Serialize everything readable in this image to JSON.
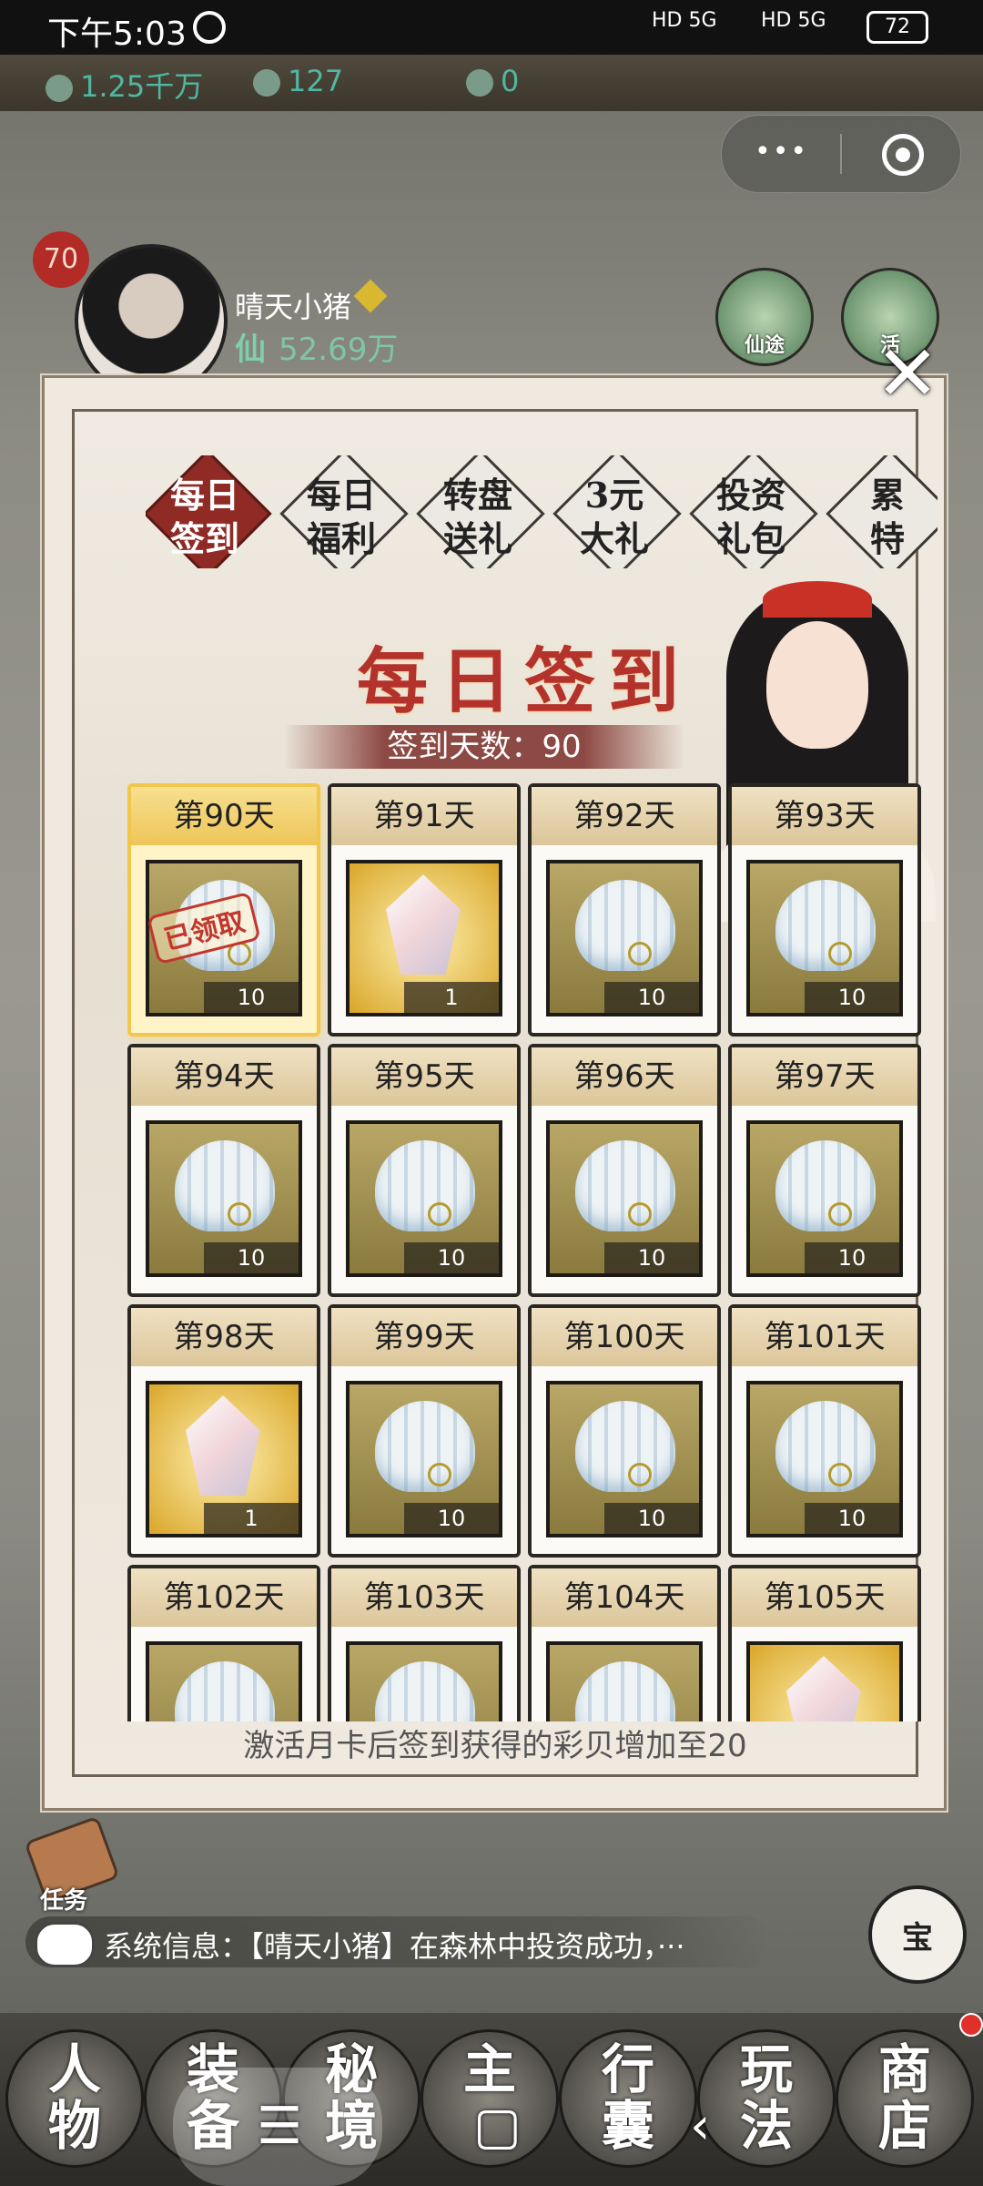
{
  "status_bar": {
    "time": "下午5:03",
    "network": "HD 5G",
    "network2": "HD 5G",
    "battery": "72"
  },
  "resources": [
    {
      "icon": "jade-leaf-icon",
      "value": "1.25千万"
    },
    {
      "icon": "shell-coin-icon",
      "value": "127"
    },
    {
      "icon": "bamboo-icon",
      "value": "0"
    }
  ],
  "capsule": {
    "more": "•••",
    "close": "◉"
  },
  "player": {
    "level": "70",
    "name": "晴天小猪",
    "power_prefix": "仙",
    "power": "52.69万"
  },
  "top_icons": [
    {
      "label": "仙途"
    },
    {
      "label": "活"
    }
  ],
  "dialog": {
    "close": "✕",
    "tabs": [
      {
        "label": "每日\n签到",
        "active": true
      },
      {
        "label": "每日\n福利",
        "active": false
      },
      {
        "label": "转盘\n送礼",
        "active": false
      },
      {
        "label": "3元\n大礼",
        "active": false
      },
      {
        "label": "投资\n礼包",
        "active": false
      },
      {
        "label": "累\n特",
        "active": false
      }
    ],
    "title": "每日签到",
    "day_count": "签到天数：90",
    "claimed_stamp": "已领取",
    "notice": "激活月卡后签到获得的彩贝增加至20",
    "days": [
      {
        "label": "第90天",
        "item": "shell",
        "qty": "10",
        "claimed": true
      },
      {
        "label": "第91天",
        "item": "crystal",
        "qty": "1",
        "claimed": false
      },
      {
        "label": "第92天",
        "item": "shell",
        "qty": "10",
        "claimed": false
      },
      {
        "label": "第93天",
        "item": "shell",
        "qty": "10",
        "claimed": false
      },
      {
        "label": "第94天",
        "item": "shell",
        "qty": "10",
        "claimed": false
      },
      {
        "label": "第95天",
        "item": "shell",
        "qty": "10",
        "claimed": false
      },
      {
        "label": "第96天",
        "item": "shell",
        "qty": "10",
        "claimed": false
      },
      {
        "label": "第97天",
        "item": "shell",
        "qty": "10",
        "claimed": false
      },
      {
        "label": "第98天",
        "item": "crystal",
        "qty": "1",
        "claimed": false
      },
      {
        "label": "第99天",
        "item": "shell",
        "qty": "10",
        "claimed": false
      },
      {
        "label": "第100天",
        "item": "shell",
        "qty": "10",
        "claimed": false
      },
      {
        "label": "第101天",
        "item": "shell",
        "qty": "10",
        "claimed": false
      },
      {
        "label": "第102天",
        "item": "shell",
        "qty": "",
        "claimed": false
      },
      {
        "label": "第103天",
        "item": "shell",
        "qty": "",
        "claimed": false
      },
      {
        "label": "第104天",
        "item": "shell",
        "qty": "",
        "claimed": false
      },
      {
        "label": "第105天",
        "item": "crystal",
        "qty": "",
        "claimed": false
      }
    ]
  },
  "task": {
    "label": "任务"
  },
  "system_message": "系统信息：【晴天小猪】在森林中投资成功，···",
  "treasure": {
    "label": "宝"
  },
  "bottom_nav": [
    {
      "label": "人\n物"
    },
    {
      "label": "装\n备"
    },
    {
      "label": "秘\n境"
    },
    {
      "label": "主"
    },
    {
      "label": "行\n囊"
    },
    {
      "label": "玩\n法"
    },
    {
      "label": "商\n店"
    }
  ],
  "system_nav": {
    "menu": "☰",
    "home": "▢",
    "back": "‹"
  }
}
